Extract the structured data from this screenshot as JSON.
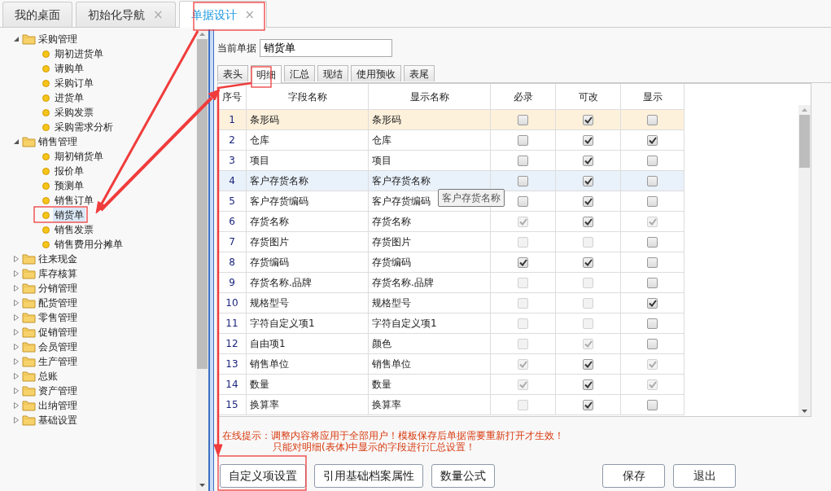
{
  "tabs": [
    {
      "label": "我的桌面",
      "selected": false
    },
    {
      "label": "初始化导航",
      "selected": false,
      "close": "×"
    },
    {
      "label": "单据设计",
      "selected": true,
      "close": "×"
    }
  ],
  "sidebar": {
    "items": [
      {
        "label": "采购管理",
        "expanded": true,
        "children": [
          {
            "label": "期初进货单",
            "selected": false
          },
          {
            "label": "请购单",
            "selected": false
          },
          {
            "label": "采购订单",
            "selected": false
          },
          {
            "label": "进货单",
            "selected": false
          },
          {
            "label": "采购发票",
            "selected": false
          },
          {
            "label": "采购需求分析",
            "selected": false
          }
        ]
      },
      {
        "label": "销售管理",
        "expanded": true,
        "children": [
          {
            "label": "期初销货单",
            "selected": false
          },
          {
            "label": "报价单",
            "selected": false
          },
          {
            "label": "预测单",
            "selected": false
          },
          {
            "label": "销售订单",
            "selected": false
          },
          {
            "label": "销货单",
            "selected": true
          },
          {
            "label": "销售发票",
            "selected": false
          },
          {
            "label": "销售费用分摊单",
            "selected": false
          }
        ]
      },
      {
        "label": "往来现金",
        "expanded": false
      },
      {
        "label": "库存核算",
        "expanded": false
      },
      {
        "label": "分销管理",
        "expanded": false
      },
      {
        "label": "配货管理",
        "expanded": false
      },
      {
        "label": "零售管理",
        "expanded": false
      },
      {
        "label": "促销管理",
        "expanded": false
      },
      {
        "label": "会员管理",
        "expanded": false
      },
      {
        "label": "生产管理",
        "expanded": false
      },
      {
        "label": "总账",
        "expanded": false
      },
      {
        "label": "资产管理",
        "expanded": false
      },
      {
        "label": "出纳管理",
        "expanded": false
      },
      {
        "label": "基础设置",
        "expanded": false
      }
    ]
  },
  "current_form": {
    "label": "当前单据",
    "value": "销货单"
  },
  "sub_tabs": [
    {
      "label": "表头",
      "selected": false
    },
    {
      "label": "明细",
      "selected": true
    },
    {
      "label": "汇总",
      "selected": false
    },
    {
      "label": "现结",
      "selected": false
    },
    {
      "label": "使用预收",
      "selected": false
    },
    {
      "label": "表尾",
      "selected": false
    }
  ],
  "table": {
    "columns": [
      "序号",
      "字段名称",
      "显示名称",
      "必录",
      "可改",
      "显示"
    ],
    "rows": [
      {
        "no": "1",
        "field": "条形码",
        "display": "条形码",
        "selected": true,
        "hovered": false,
        "required": {
          "checked": false,
          "disabled": false
        },
        "editable": {
          "checked": true,
          "disabled": false
        },
        "visible": {
          "checked": false,
          "disabled": false
        }
      },
      {
        "no": "2",
        "field": "仓库",
        "display": "仓库",
        "selected": false,
        "hovered": false,
        "required": {
          "checked": false,
          "disabled": false
        },
        "editable": {
          "checked": true,
          "disabled": false
        },
        "visible": {
          "checked": true,
          "disabled": false
        }
      },
      {
        "no": "3",
        "field": "项目",
        "display": "项目",
        "selected": false,
        "hovered": false,
        "required": {
          "checked": false,
          "disabled": false
        },
        "editable": {
          "checked": true,
          "disabled": false
        },
        "visible": {
          "checked": false,
          "disabled": false
        }
      },
      {
        "no": "4",
        "field": "客户存货名称",
        "display": "客户存货名称",
        "selected": false,
        "hovered": true,
        "required": {
          "checked": false,
          "disabled": false
        },
        "editable": {
          "checked": true,
          "disabled": false
        },
        "visible": {
          "checked": false,
          "disabled": false
        }
      },
      {
        "no": "5",
        "field": "客户存货编码",
        "display": "客户存货编码",
        "selected": false,
        "hovered": false,
        "required": {
          "checked": false,
          "disabled": false
        },
        "editable": {
          "checked": true,
          "disabled": false
        },
        "visible": {
          "checked": false,
          "disabled": false
        }
      },
      {
        "no": "6",
        "field": "存货名称",
        "display": "存货名称",
        "selected": false,
        "hovered": false,
        "required": {
          "checked": true,
          "disabled": true
        },
        "editable": {
          "checked": true,
          "disabled": false
        },
        "visible": {
          "checked": true,
          "disabled": true
        }
      },
      {
        "no": "7",
        "field": "存货图片",
        "display": "存货图片",
        "selected": false,
        "hovered": false,
        "required": {
          "checked": false,
          "disabled": true
        },
        "editable": {
          "checked": false,
          "disabled": true
        },
        "visible": {
          "checked": false,
          "disabled": false
        }
      },
      {
        "no": "8",
        "field": "存货编码",
        "display": "存货编码",
        "selected": false,
        "hovered": false,
        "required": {
          "checked": true,
          "disabled": false
        },
        "editable": {
          "checked": true,
          "disabled": false
        },
        "visible": {
          "checked": false,
          "disabled": false
        }
      },
      {
        "no": "9",
        "field": "存货名称.品牌",
        "display": "存货名称.品牌",
        "selected": false,
        "hovered": false,
        "required": {
          "checked": false,
          "disabled": true
        },
        "editable": {
          "checked": false,
          "disabled": true
        },
        "visible": {
          "checked": false,
          "disabled": false
        }
      },
      {
        "no": "10",
        "field": "规格型号",
        "display": "规格型号",
        "selected": false,
        "hovered": false,
        "required": {
          "checked": false,
          "disabled": true
        },
        "editable": {
          "checked": false,
          "disabled": true
        },
        "visible": {
          "checked": true,
          "disabled": false
        }
      },
      {
        "no": "11",
        "field": "字符自定义项1",
        "display": "字符自定义项1",
        "selected": false,
        "hovered": false,
        "required": {
          "checked": false,
          "disabled": true
        },
        "editable": {
          "checked": false,
          "disabled": true
        },
        "visible": {
          "checked": false,
          "disabled": false
        }
      },
      {
        "no": "12",
        "field": "自由项1",
        "display": "颜色",
        "selected": false,
        "hovered": false,
        "required": {
          "checked": false,
          "disabled": true
        },
        "editable": {
          "checked": true,
          "disabled": true
        },
        "visible": {
          "checked": false,
          "disabled": false
        }
      },
      {
        "no": "13",
        "field": "销售单位",
        "display": "销售单位",
        "selected": false,
        "hovered": false,
        "required": {
          "checked": true,
          "disabled": true
        },
        "editable": {
          "checked": true,
          "disabled": false
        },
        "visible": {
          "checked": true,
          "disabled": true
        }
      },
      {
        "no": "14",
        "field": "数量",
        "display": "数量",
        "selected": false,
        "hovered": false,
        "required": {
          "checked": true,
          "disabled": true
        },
        "editable": {
          "checked": true,
          "disabled": false
        },
        "visible": {
          "checked": true,
          "disabled": true
        }
      },
      {
        "no": "15",
        "field": "换算率",
        "display": "换算率",
        "selected": false,
        "hovered": false,
        "required": {
          "checked": false,
          "disabled": true
        },
        "editable": {
          "checked": true,
          "disabled": false
        },
        "visible": {
          "checked": false,
          "disabled": false
        }
      }
    ]
  },
  "tooltip": "客户存货名称",
  "hints": [
    "在线提示：调整内容将应用于全部用户！模板保存后单据需要重新打开才生效！",
    "只能对明细(表体)中显示的字段进行汇总设置！"
  ],
  "buttons_left": [
    "自定义项设置",
    "引用基础档案属性",
    "数量公式"
  ],
  "buttons_right": [
    "保存",
    "退出"
  ]
}
